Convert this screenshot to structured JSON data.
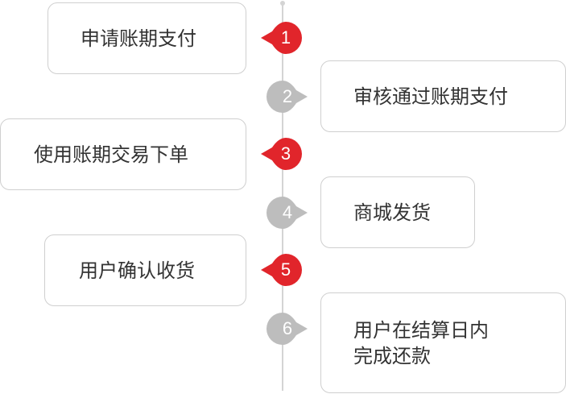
{
  "colors": {
    "active": "#e1252b",
    "inactive": "#bdbdbd",
    "line": "#d4d4d4",
    "border": "#cfcfcf",
    "text": "#333333"
  },
  "steps": [
    {
      "number": "1",
      "text": "申请账期支付",
      "state": "active"
    },
    {
      "number": "2",
      "text": "审核通过账期支付",
      "state": "inactive"
    },
    {
      "number": "3",
      "text": "使用账期交易下单",
      "state": "active"
    },
    {
      "number": "4",
      "text": "商城发货",
      "state": "inactive"
    },
    {
      "number": "5",
      "text": "用户确认收货",
      "state": "active"
    },
    {
      "number": "6",
      "text": "用户在结算日内\n完成还款",
      "state": "inactive"
    }
  ]
}
